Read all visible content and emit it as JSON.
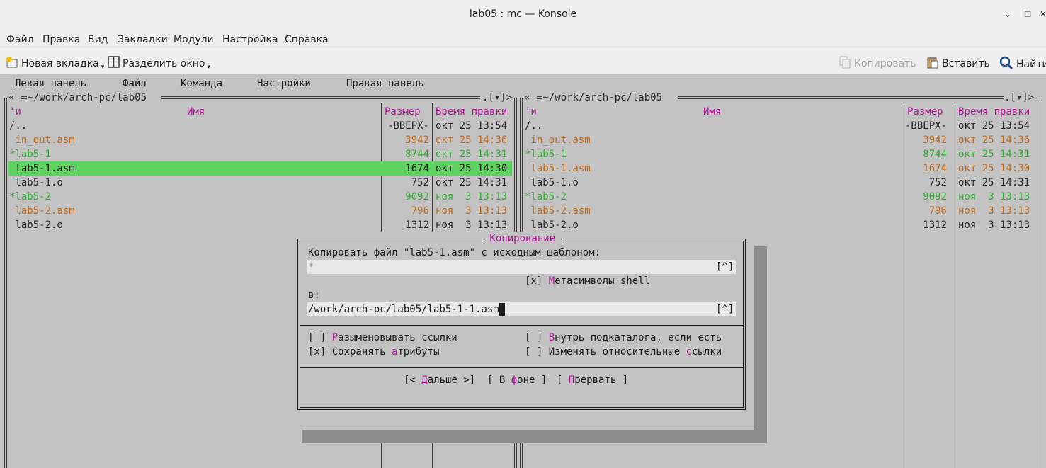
{
  "window": {
    "title": "lab05 : mc — Konsole",
    "buttons": [
      "minimize-icon",
      "maximize-icon",
      "close-icon"
    ]
  },
  "menubar": [
    "Файл",
    "Правка",
    "Вид",
    "Закладки",
    "Модули",
    "Настройка",
    "Справка"
  ],
  "toolbar": {
    "new_tab": "Новая вкладка",
    "split": "Разделить окно",
    "copy": "Копировать",
    "paste": "Вставить",
    "find": "Найти"
  },
  "mc_menu": [
    "Левая панель",
    "Файл",
    "Команда",
    "Настройки",
    "Правая панель"
  ],
  "panels": {
    "left": {
      "path": " ~/work/arch-pc/lab05 ",
      "indicator": "[",
      "indicator_arrow": "^",
      "hdr_sort": "'и",
      "hdr_name": "Имя",
      "hdr_size": "Размер",
      "hdr_time": "Время правки"
    },
    "right": {
      "path": " ~/work/arch-pc/lab05 ",
      "hdr_sort": "'и",
      "hdr_name": "Имя",
      "hdr_size": "Размер",
      "hdr_time": "Время правки"
    },
    "files": [
      {
        "name": "/..",
        "size": "-ВВЕРХ-",
        "time": "окт 25 13:54",
        "color": "gray"
      },
      {
        "name": " in_out.asm",
        "size": "3942",
        "time": "окт 25 14:36",
        "color": "orange"
      },
      {
        "name": "*lab5-1",
        "size": "8744",
        "time": "окт 25 14:31",
        "color": "green"
      },
      {
        "name": " lab5-1.asm",
        "size": "1674",
        "time": "окт 25 14:30",
        "color": "orange"
      },
      {
        "name": " lab5-1.o",
        "size": "752",
        "time": "окт 25 14:31",
        "color": "gray"
      },
      {
        "name": "*lab5-2",
        "size": "9092",
        "time": "ноя  3 13:13",
        "color": "green"
      },
      {
        "name": " lab5-2.asm",
        "size": "796",
        "time": "ноя  3 13:13",
        "color": "orange"
      },
      {
        "name": " lab5-2.o",
        "size": "1312",
        "time": "ноя  3 13:13",
        "color": "gray"
      }
    ],
    "left_selected_index": 3
  },
  "dialog": {
    "title": " Копирование ",
    "source_label": "Копировать файл \"lab5-1.asm\" с исходным шаблоном:",
    "source_value": "*",
    "history_btn": "[^]",
    "shell_check": "[x] ",
    "shell_hk": "М",
    "shell_rest": "етасимволы shell",
    "to_label": "в:",
    "dest_value": "/work/arch-pc/lab05/lab5-1-1.asm",
    "opt1_box": "[ ] ",
    "opt1_hk": "Р",
    "opt1_rest": "азыменовывать ссылки",
    "opt2_box": "[x] Сохранять ",
    "opt2_hk": "а",
    "opt2_rest": "трибуты",
    "opt3_box": "[ ] ",
    "opt3_hk": "В",
    "opt3_rest": "нутрь подкаталога, если есть",
    "opt4_box": "[ ] Изменять относительные ",
    "opt4_hk": "с",
    "opt4_rest": "сылки",
    "btn_next_pre": "[< ",
    "btn_next_hk": "Д",
    "btn_next_rest": "альше >]",
    "btn_bg_pre": "[ В ",
    "btn_bg_hk": "ф",
    "btn_bg_rest": "оне ]",
    "btn_abort_pre": "[ ",
    "btn_abort_hk": "П",
    "btn_abort_rest": "рервать ]"
  },
  "colors": {
    "selection": "#5fd35f",
    "hotkey": "#b4129e",
    "exec": "#2fae2f",
    "source": "#c06a1a",
    "terminal_bg": "#c3c3c3"
  }
}
